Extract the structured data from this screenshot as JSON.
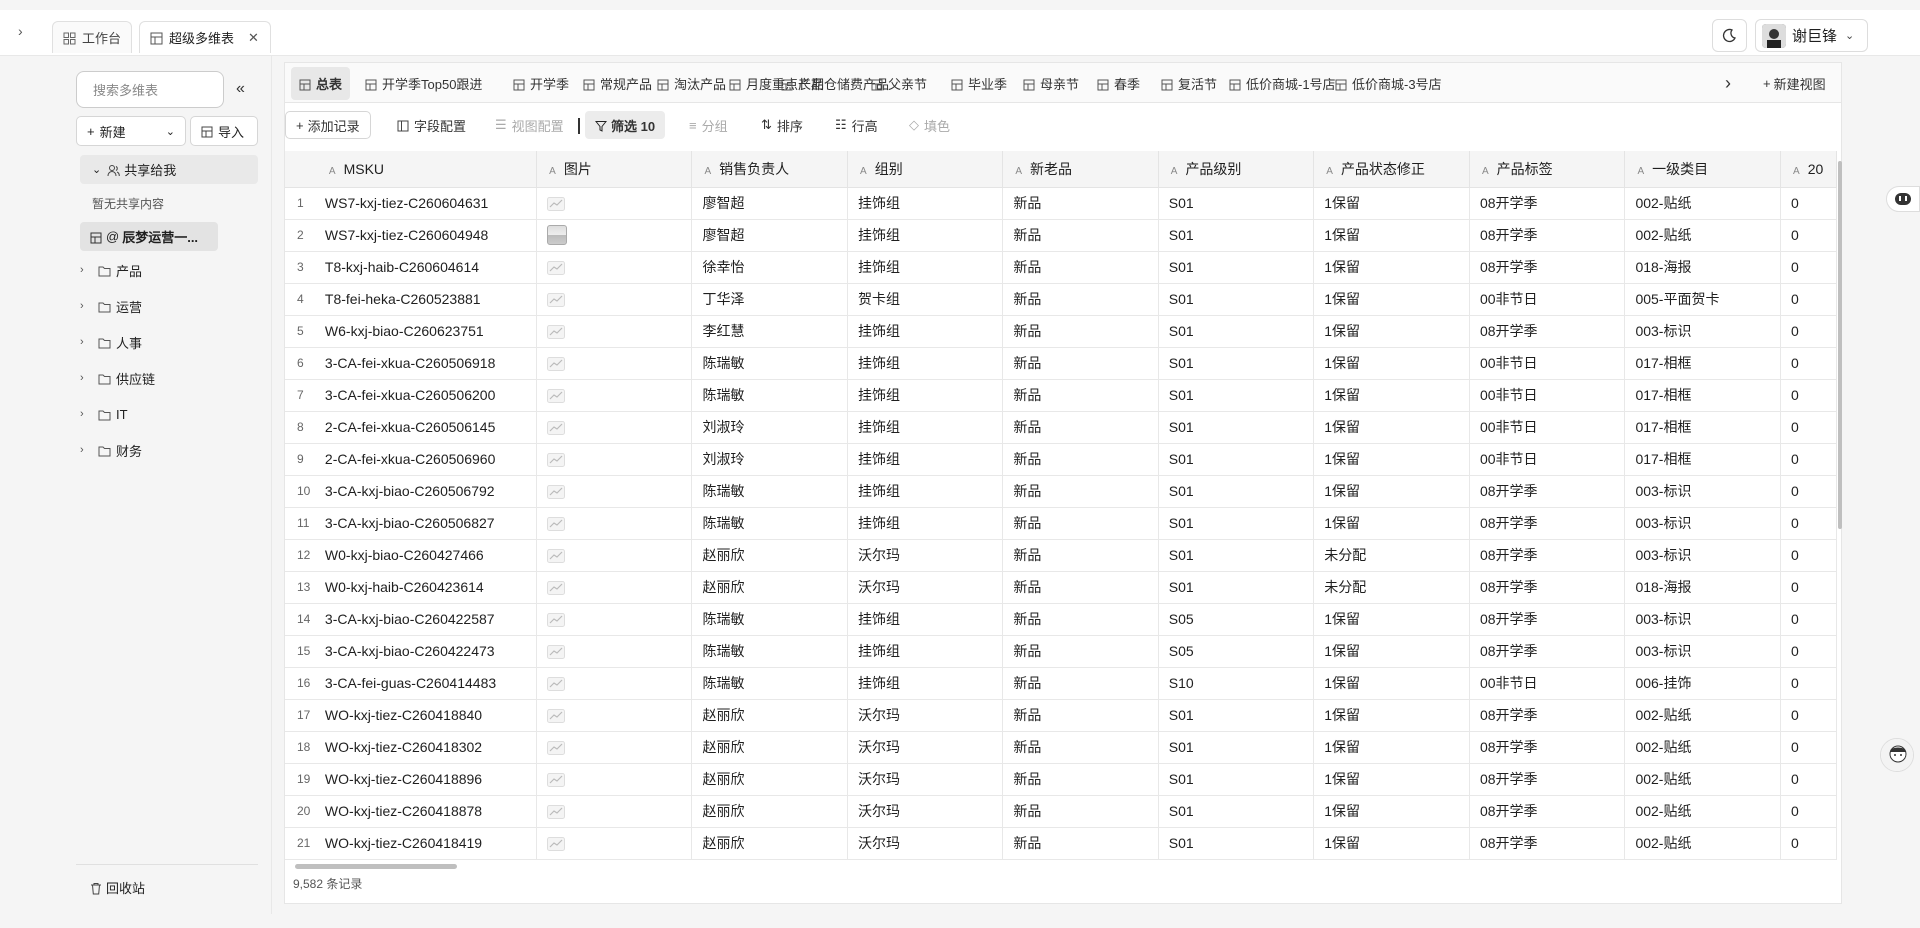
{
  "top_tabs": [
    {
      "label": "工作台",
      "icon": "grid-icon"
    },
    {
      "label": "超级多维表",
      "icon": "table-icon"
    }
  ],
  "user": {
    "name": "谢巨锋"
  },
  "sidebar": {
    "search_placeholder": "搜索多维表",
    "new_label": "新建",
    "import_label": "导入",
    "shared_label": "共享给我",
    "shared_empty": "暂无共享内容",
    "active_table": "辰梦运营一...",
    "folders": [
      "产品",
      "运营",
      "人事",
      "供应链",
      "IT",
      "财务"
    ],
    "trash_label": "回收站"
  },
  "view_tabs": [
    "总表",
    "开学季Top50跟进",
    "开学季",
    "常规产品",
    "淘汰产品",
    "月度重点产品",
    "长期仓储费产品",
    "父亲节",
    "毕业季",
    "母亲节",
    "春季",
    "复活节",
    "低价商城-1号店",
    "低价商城-3号店"
  ],
  "new_view_label": "新建视图",
  "toolbar": {
    "add_record": "添加记录",
    "field_config": "字段配置",
    "view_config": "视图配置",
    "filter": "筛选 10",
    "group": "分组",
    "sort": "排序",
    "row_height": "行高",
    "fill": "填色"
  },
  "columns": [
    "MSKU",
    "图片",
    "销售负责人",
    "组别",
    "新老品",
    "产品级别",
    "产品状态修正",
    "产品标签",
    "一级类目",
    "20"
  ],
  "rows": [
    [
      "1",
      "WS7-kxj-tiez-C260604631",
      "chart",
      "廖智超",
      "挂饰组",
      "新品",
      "S01",
      "1保留",
      "08开学季",
      "002-贴纸",
      "0"
    ],
    [
      "2",
      "WS7-kxj-tiez-C260604948",
      "photo",
      "廖智超",
      "挂饰组",
      "新品",
      "S01",
      "1保留",
      "08开学季",
      "002-贴纸",
      "0"
    ],
    [
      "3",
      "T8-kxj-haib-C260604614",
      "chart",
      "徐幸怡",
      "挂饰组",
      "新品",
      "S01",
      "1保留",
      "08开学季",
      "018-海报",
      "0"
    ],
    [
      "4",
      "T8-fei-heka-C260523881",
      "chart",
      "丁华泽",
      "贺卡组",
      "新品",
      "S01",
      "1保留",
      "00非节日",
      "005-平面贺卡",
      "0"
    ],
    [
      "5",
      "W6-kxj-biao-C260623751",
      "chart",
      "李红慧",
      "挂饰组",
      "新品",
      "S01",
      "1保留",
      "08开学季",
      "003-标识",
      "0"
    ],
    [
      "6",
      "3-CA-fei-xkua-C260506918",
      "chart",
      "陈瑞敏",
      "挂饰组",
      "新品",
      "S01",
      "1保留",
      "00非节日",
      "017-相框",
      "0"
    ],
    [
      "7",
      "3-CA-fei-xkua-C260506200",
      "chart",
      "陈瑞敏",
      "挂饰组",
      "新品",
      "S01",
      "1保留",
      "00非节日",
      "017-相框",
      "0"
    ],
    [
      "8",
      "2-CA-fei-xkua-C260506145",
      "chart",
      "刘淑玲",
      "挂饰组",
      "新品",
      "S01",
      "1保留",
      "00非节日",
      "017-相框",
      "0"
    ],
    [
      "9",
      "2-CA-fei-xkua-C260506960",
      "chart",
      "刘淑玲",
      "挂饰组",
      "新品",
      "S01",
      "1保留",
      "00非节日",
      "017-相框",
      "0"
    ],
    [
      "10",
      "3-CA-kxj-biao-C260506792",
      "chart",
      "陈瑞敏",
      "挂饰组",
      "新品",
      "S01",
      "1保留",
      "08开学季",
      "003-标识",
      "0"
    ],
    [
      "11",
      "3-CA-kxj-biao-C260506827",
      "chart",
      "陈瑞敏",
      "挂饰组",
      "新品",
      "S01",
      "1保留",
      "08开学季",
      "003-标识",
      "0"
    ],
    [
      "12",
      "W0-kxj-biao-C260427466",
      "chart",
      "赵丽欣",
      "沃尔玛",
      "新品",
      "S01",
      "未分配",
      "08开学季",
      "003-标识",
      "0"
    ],
    [
      "13",
      "W0-kxj-haib-C260423614",
      "chart",
      "赵丽欣",
      "沃尔玛",
      "新品",
      "S01",
      "未分配",
      "08开学季",
      "018-海报",
      "0"
    ],
    [
      "14",
      "3-CA-kxj-biao-C260422587",
      "chart",
      "陈瑞敏",
      "挂饰组",
      "新品",
      "S05",
      "1保留",
      "08开学季",
      "003-标识",
      "0"
    ],
    [
      "15",
      "3-CA-kxj-biao-C260422473",
      "chart",
      "陈瑞敏",
      "挂饰组",
      "新品",
      "S05",
      "1保留",
      "08开学季",
      "003-标识",
      "0"
    ],
    [
      "16",
      "3-CA-fei-guas-C260414483",
      "chart",
      "陈瑞敏",
      "挂饰组",
      "新品",
      "S10",
      "1保留",
      "00非节日",
      "006-挂饰",
      "0"
    ],
    [
      "17",
      "WO-kxj-tiez-C260418840",
      "chart",
      "赵丽欣",
      "沃尔玛",
      "新品",
      "S01",
      "1保留",
      "08开学季",
      "002-贴纸",
      "0"
    ],
    [
      "18",
      "WO-kxj-tiez-C260418302",
      "chart",
      "赵丽欣",
      "沃尔玛",
      "新品",
      "S01",
      "1保留",
      "08开学季",
      "002-贴纸",
      "0"
    ],
    [
      "19",
      "WO-kxj-tiez-C260418896",
      "chart",
      "赵丽欣",
      "沃尔玛",
      "新品",
      "S01",
      "1保留",
      "08开学季",
      "002-贴纸",
      "0"
    ],
    [
      "20",
      "WO-kxj-tiez-C260418878",
      "chart",
      "赵丽欣",
      "沃尔玛",
      "新品",
      "S01",
      "1保留",
      "08开学季",
      "002-贴纸",
      "0"
    ],
    [
      "21",
      "WO-kxj-tiez-C260418419",
      "chart",
      "赵丽欣",
      "沃尔玛",
      "新品",
      "S01",
      "1保留",
      "08开学季",
      "002-贴纸",
      "0"
    ]
  ],
  "footer": {
    "record_count": "9,582 条记录"
  }
}
